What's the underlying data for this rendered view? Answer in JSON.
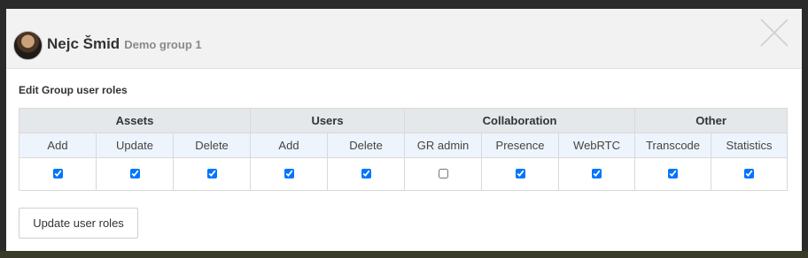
{
  "header": {
    "user_name": "Nejc Šmid",
    "group_name": "Demo group 1",
    "close_icon": "close-icon"
  },
  "section": {
    "title": "Edit Group user roles"
  },
  "roles_table": {
    "groups": [
      {
        "label": "Assets",
        "span": 3
      },
      {
        "label": "Users",
        "span": 2
      },
      {
        "label": "Collaboration",
        "span": 3
      },
      {
        "label": "Other",
        "span": 2
      }
    ],
    "permissions": [
      {
        "label": "Add",
        "checked": true
      },
      {
        "label": "Update",
        "checked": true
      },
      {
        "label": "Delete",
        "checked": true
      },
      {
        "label": "Add",
        "checked": true
      },
      {
        "label": "Delete",
        "checked": true
      },
      {
        "label": "GR admin",
        "checked": false
      },
      {
        "label": "Presence",
        "checked": true
      },
      {
        "label": "WebRTC",
        "checked": true
      },
      {
        "label": "Transcode",
        "checked": true
      },
      {
        "label": "Statistics",
        "checked": true
      }
    ]
  },
  "actions": {
    "update_label": "Update user roles"
  }
}
